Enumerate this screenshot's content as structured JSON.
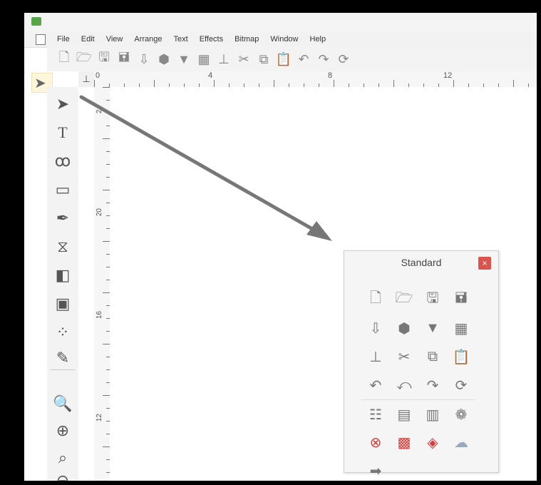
{
  "menu": {
    "items": [
      "File",
      "Edit",
      "View",
      "Arrange",
      "Text",
      "Effects",
      "Bitmap",
      "Window",
      "Help"
    ]
  },
  "toolbar": {
    "icons": [
      "new-document-icon",
      "open-icon",
      "save-icon",
      "save-as-icon",
      "import-icon",
      "export-icon",
      "print-icon",
      "page-setup-icon",
      "scan-icon",
      "cut-icon",
      "copy-icon",
      "paste-icon",
      "undo-icon",
      "redo-icon",
      "redo-all-icon"
    ]
  },
  "ruler": {
    "top_labels": [
      "0",
      "4",
      "8",
      "12"
    ],
    "left_labels": [
      "24",
      "20",
      "16",
      "12"
    ]
  },
  "standard_panel": {
    "title": "Standard",
    "close": "×",
    "icons": [
      "new-document-icon",
      "open-icon",
      "save-icon",
      "save-as-icon",
      "import-icon",
      "export-icon",
      "print-icon",
      "page-setup-icon",
      "scan-icon",
      "cut-icon",
      "copy-icon",
      "paste-icon",
      "undo-icon",
      "undo-all-icon",
      "redo-icon",
      "redo-all-icon",
      "properties-icon",
      "object-manager-icon",
      "bitmap-icon",
      "color-palette-icon",
      "zoom-icon",
      "swatch-icon",
      "color-picker-icon",
      "cloud-icon",
      "send-icon"
    ]
  }
}
